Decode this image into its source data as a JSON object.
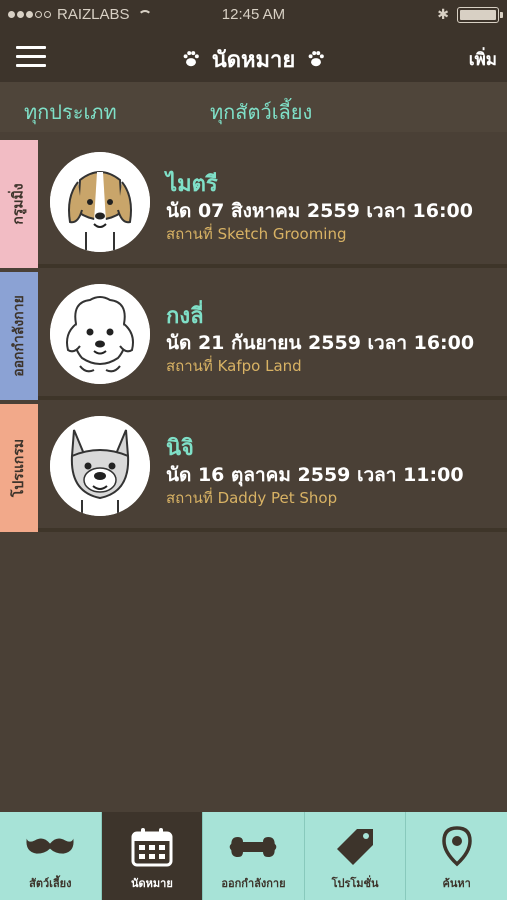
{
  "status_bar": {
    "carrier": "RAIZLABS",
    "time": "12:45 AM"
  },
  "header": {
    "title": "นัดหมาย",
    "add_label": "เพิ่ม"
  },
  "filters": {
    "type": "ทุกประเภท",
    "pet": "ทุกสัตว์เลี้ยง"
  },
  "appointments": [
    {
      "category": "กรูมมิ่ง",
      "category_color": "#f2bcc4",
      "name": "ไมตรี",
      "date": "นัด 07 สิงหาคม 2559 เวลา 16:00",
      "place": "สถานที่ Sketch Grooming"
    },
    {
      "category": "ออกกำลังกาย",
      "category_color": "#8ba2d4",
      "name": "กงลี่",
      "date": "นัด 21 กันยายน 2559 เวลา 16:00",
      "place": "สถานที่ Kafpo Land"
    },
    {
      "category": "โปรแกรม",
      "category_color": "#f2a98a",
      "name": "นิจิ",
      "date": "นัด 16 ตุลาคม 2559 เวลา 11:00",
      "place": "สถานที่ Daddy Pet Shop"
    }
  ],
  "tabs": [
    {
      "label": "สัตว์เลี้ยง",
      "icon": "mustache-icon"
    },
    {
      "label": "นัดหมาย",
      "icon": "calendar-icon"
    },
    {
      "label": "ออกกำลังกาย",
      "icon": "bone-icon"
    },
    {
      "label": "โปรโมชั่น",
      "icon": "tag-icon"
    },
    {
      "label": "ค้นหา",
      "icon": "location-pin-icon"
    }
  ],
  "colors": {
    "background": "#4a4036",
    "header": "#3d342b",
    "accent_teal": "#7fe0c8",
    "place_gold": "#d8b264",
    "tabbar": "#a7e3d7"
  }
}
